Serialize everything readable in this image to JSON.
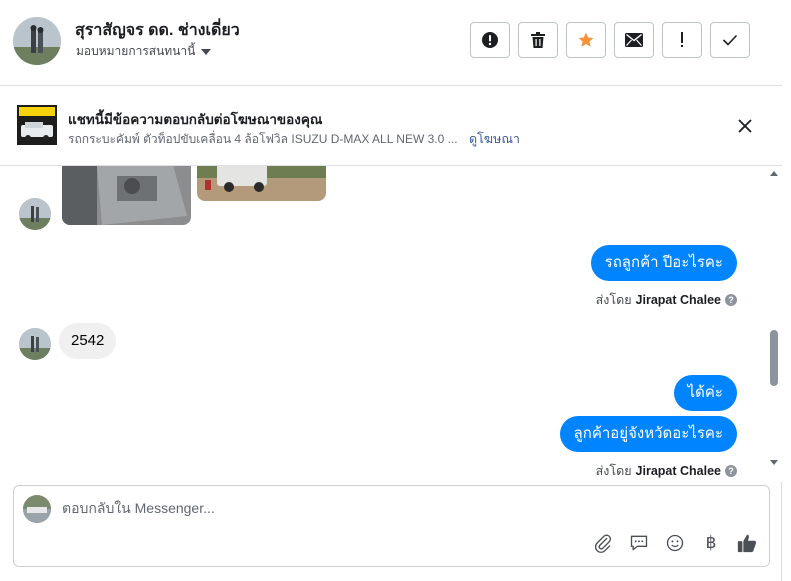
{
  "header": {
    "contact_name": "สุราสัญจร ดด. ช่างเดี่ยว",
    "assign_label": "มอบหมายการสนทนานี้",
    "actions": [
      {
        "name": "spam-button",
        "icon": "exclamation-circle-icon"
      },
      {
        "name": "delete-button",
        "icon": "trash-icon"
      },
      {
        "name": "star-button",
        "icon": "star-icon",
        "color": "#f7923a"
      },
      {
        "name": "mark-unread-button",
        "icon": "envelope-icon"
      },
      {
        "name": "follow-up-button",
        "icon": "exclamation-icon"
      },
      {
        "name": "mark-done-button",
        "icon": "check-icon"
      }
    ]
  },
  "ad_banner": {
    "title": "แชทนี้มีข้อความตอบกลับต่อโฆษณาของคุณ",
    "description": "รถกระบะคัมพ์ ตัวท็อปขับเคลื่อน 4 ล้อโฟวิล ISUZU D-MAX ALL NEW 3.0 ...",
    "link": "ดูโฆษณา"
  },
  "messages": [
    {
      "direction": "in",
      "type": "images"
    },
    {
      "direction": "out",
      "text": "รถลูกค้า ปีอะไรคะ",
      "sent_by_prefix": "ส่งโดย",
      "sent_by_name": "Jirapat Chalee"
    },
    {
      "direction": "in",
      "text": "2542"
    },
    {
      "direction": "out",
      "text": "ได้ค่ะ"
    },
    {
      "direction": "out",
      "text": "ลูกค้าอยู่จังหวัดอะไรคะ",
      "sent_by_prefix": "ส่งโดย",
      "sent_by_name": "Jirapat Chalee"
    }
  ],
  "composer": {
    "placeholder": "ตอบกลับใน Messenger...",
    "value": "",
    "tools": [
      "paperclip-icon",
      "saved-reply-icon",
      "emoji-icon",
      "baht-icon",
      "thumbs-up-icon"
    ]
  },
  "colors": {
    "outgoing_bubble": "#0084ff",
    "incoming_bubble": "#f0f0f0",
    "star": "#f7923a",
    "link": "#385898"
  }
}
